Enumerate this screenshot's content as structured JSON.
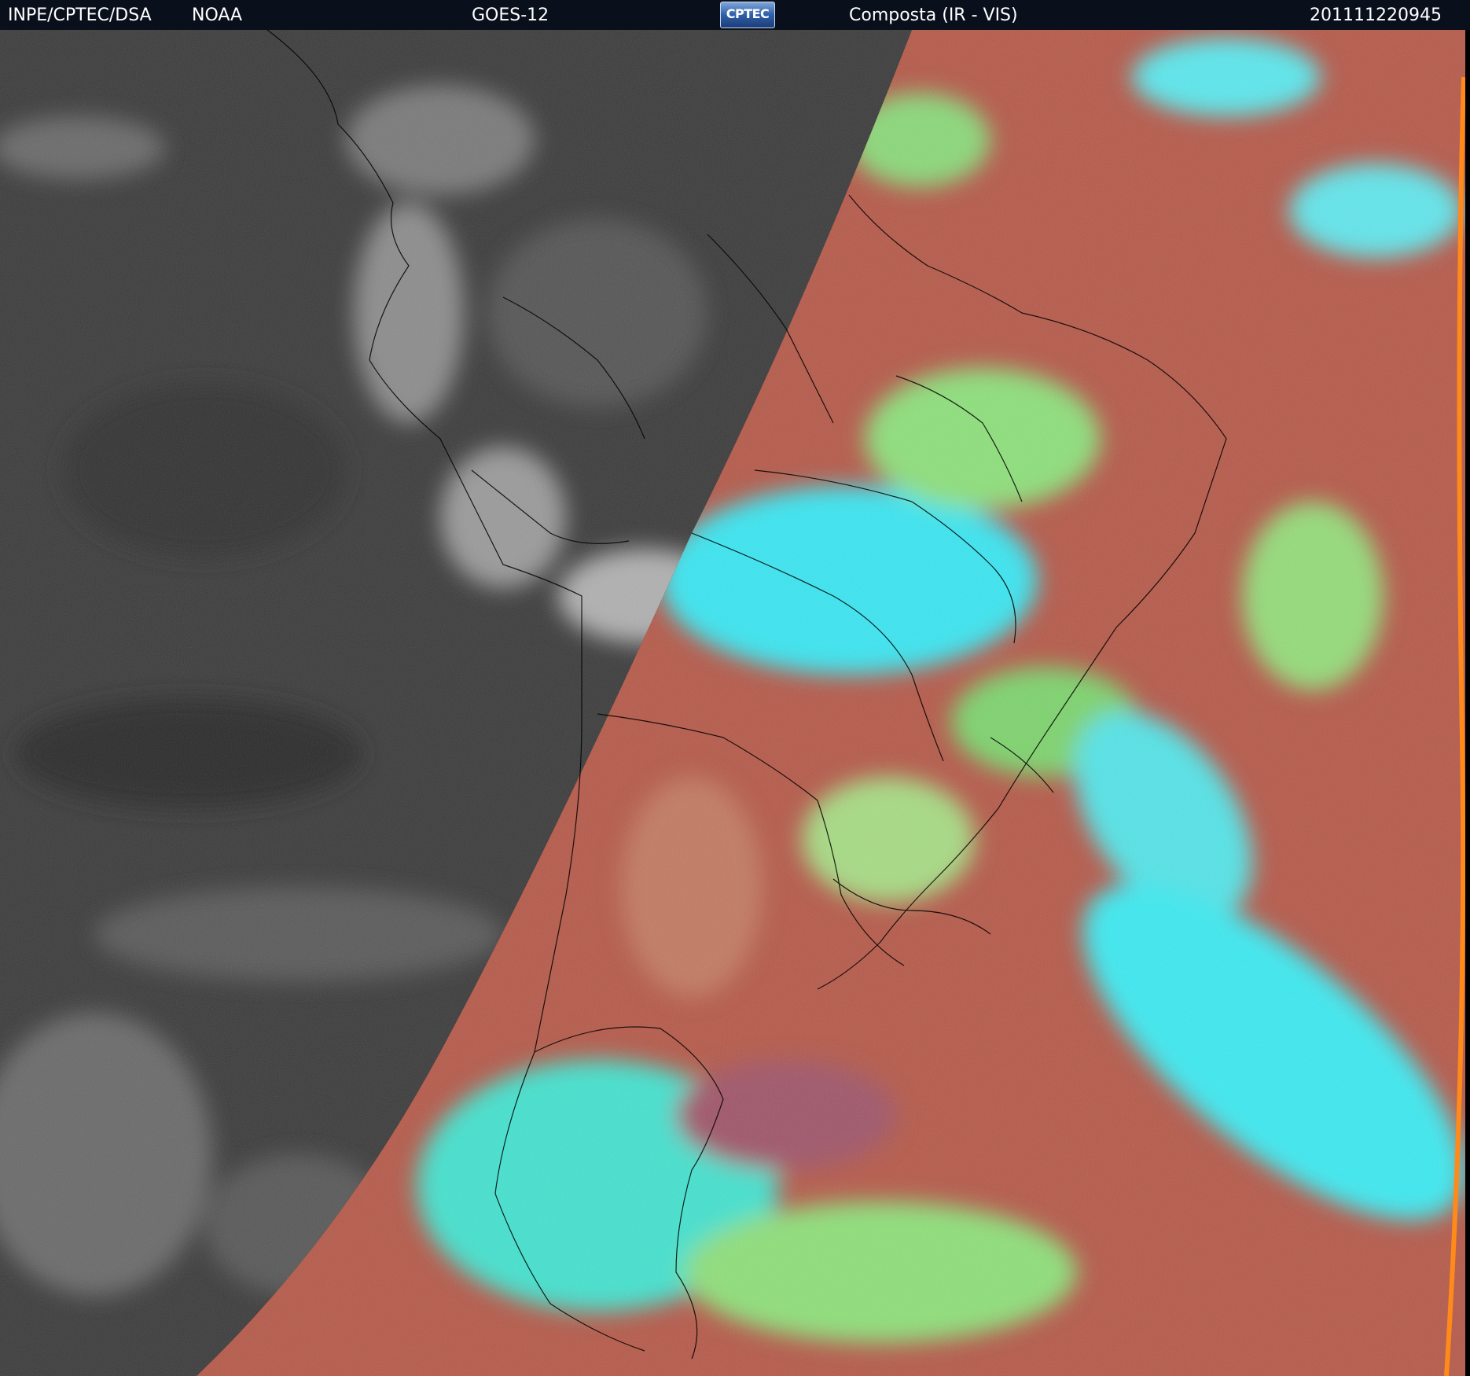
{
  "header": {
    "organization": "INPE/CPTEC/DSA",
    "agency": "NOAA",
    "satellite": "GOES-12",
    "logo_text": "CPTEC",
    "product": "Composta (IR - VIS)",
    "timestamp": "201111220945"
  },
  "colors": {
    "header_bg": "#0a0f1c",
    "night_ir_base": "#3a3a3a",
    "day_land_red": "#b8584a",
    "day_cloud_cyan": "#35e8f0",
    "day_cloud_green": "#8fe07a",
    "boundary_lines": "#000000"
  },
  "icons": {
    "logo": "cptec-logo"
  }
}
